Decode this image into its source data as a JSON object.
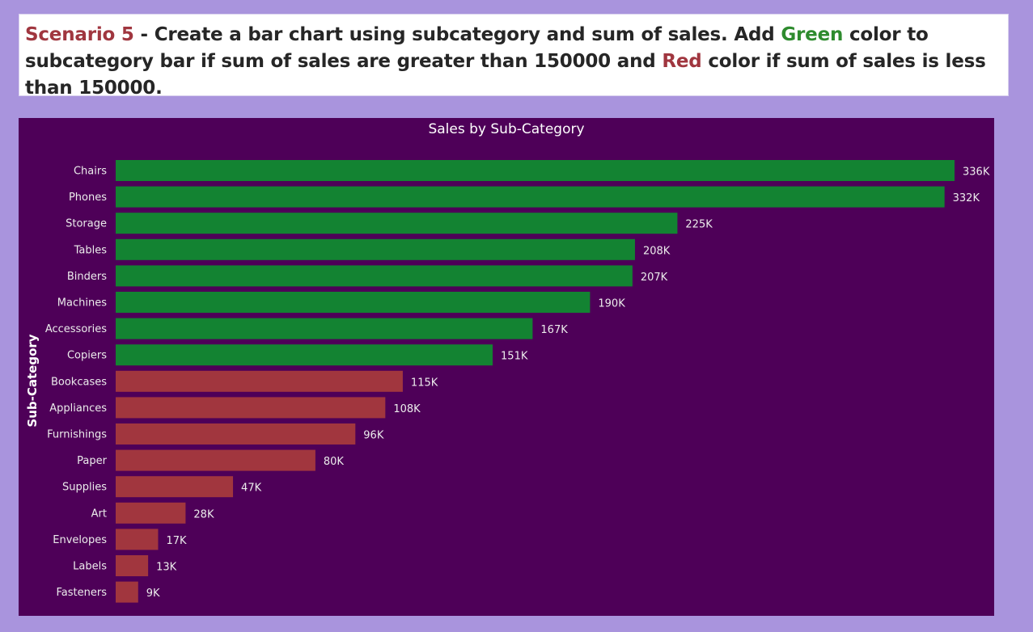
{
  "header": {
    "scenario": "Scenario 5",
    "part1": " - Create a bar chart using subcategory and sum of sales. Add ",
    "green_word": "Green",
    "part2": " color to subcategory bar if sum of sales are greater than 150000 and ",
    "red_word": "Red",
    "part3": " color if sum of sales is less than 150000."
  },
  "colors": {
    "background": "#a994dd",
    "panel": "#4e0058",
    "above_threshold": "#138332",
    "below_threshold": "#a1363e",
    "label": "#ececec"
  },
  "chart_data": {
    "type": "bar",
    "orientation": "horizontal",
    "title": "Sales by Sub-Category",
    "xlabel": "",
    "ylabel": "Sub-Category",
    "threshold": 150000,
    "xlim": [
      0,
      336000
    ],
    "grid": false,
    "categories": [
      "Chairs",
      "Phones",
      "Storage",
      "Tables",
      "Binders",
      "Machines",
      "Accessories",
      "Copiers",
      "Bookcases",
      "Appliances",
      "Furnishings",
      "Paper",
      "Supplies",
      "Art",
      "Envelopes",
      "Labels",
      "Fasteners"
    ],
    "values": [
      336000,
      332000,
      225000,
      208000,
      207000,
      190000,
      167000,
      151000,
      115000,
      108000,
      96000,
      80000,
      47000,
      28000,
      17000,
      13000,
      9000
    ],
    "value_labels": [
      "336K",
      "332K",
      "225K",
      "208K",
      "207K",
      "190K",
      "167K",
      "151K",
      "115K",
      "108K",
      "96K",
      "80K",
      "47K",
      "28K",
      "17K",
      "13K",
      "9K"
    ]
  }
}
